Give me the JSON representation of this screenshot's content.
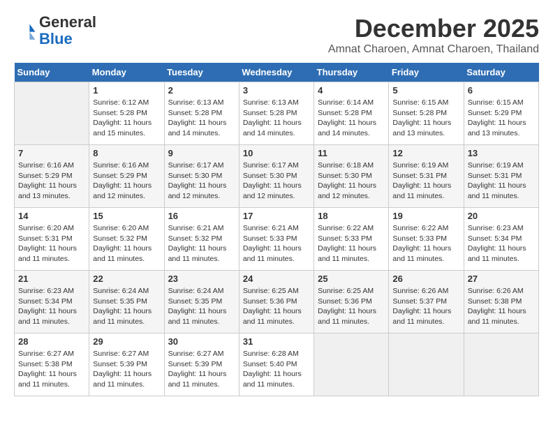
{
  "header": {
    "logo_general": "General",
    "logo_blue": "Blue",
    "month_year": "December 2025",
    "location": "Amnat Charoen, Amnat Charoen, Thailand"
  },
  "calendar": {
    "days_of_week": [
      "Sunday",
      "Monday",
      "Tuesday",
      "Wednesday",
      "Thursday",
      "Friday",
      "Saturday"
    ],
    "weeks": [
      [
        {
          "day": "",
          "info": ""
        },
        {
          "day": "1",
          "info": "Sunrise: 6:12 AM\nSunset: 5:28 PM\nDaylight: 11 hours\nand 15 minutes."
        },
        {
          "day": "2",
          "info": "Sunrise: 6:13 AM\nSunset: 5:28 PM\nDaylight: 11 hours\nand 14 minutes."
        },
        {
          "day": "3",
          "info": "Sunrise: 6:13 AM\nSunset: 5:28 PM\nDaylight: 11 hours\nand 14 minutes."
        },
        {
          "day": "4",
          "info": "Sunrise: 6:14 AM\nSunset: 5:28 PM\nDaylight: 11 hours\nand 14 minutes."
        },
        {
          "day": "5",
          "info": "Sunrise: 6:15 AM\nSunset: 5:28 PM\nDaylight: 11 hours\nand 13 minutes."
        },
        {
          "day": "6",
          "info": "Sunrise: 6:15 AM\nSunset: 5:29 PM\nDaylight: 11 hours\nand 13 minutes."
        }
      ],
      [
        {
          "day": "7",
          "info": "Sunrise: 6:16 AM\nSunset: 5:29 PM\nDaylight: 11 hours\nand 13 minutes."
        },
        {
          "day": "8",
          "info": "Sunrise: 6:16 AM\nSunset: 5:29 PM\nDaylight: 11 hours\nand 12 minutes."
        },
        {
          "day": "9",
          "info": "Sunrise: 6:17 AM\nSunset: 5:30 PM\nDaylight: 11 hours\nand 12 minutes."
        },
        {
          "day": "10",
          "info": "Sunrise: 6:17 AM\nSunset: 5:30 PM\nDaylight: 11 hours\nand 12 minutes."
        },
        {
          "day": "11",
          "info": "Sunrise: 6:18 AM\nSunset: 5:30 PM\nDaylight: 11 hours\nand 12 minutes."
        },
        {
          "day": "12",
          "info": "Sunrise: 6:19 AM\nSunset: 5:31 PM\nDaylight: 11 hours\nand 11 minutes."
        },
        {
          "day": "13",
          "info": "Sunrise: 6:19 AM\nSunset: 5:31 PM\nDaylight: 11 hours\nand 11 minutes."
        }
      ],
      [
        {
          "day": "14",
          "info": "Sunrise: 6:20 AM\nSunset: 5:31 PM\nDaylight: 11 hours\nand 11 minutes."
        },
        {
          "day": "15",
          "info": "Sunrise: 6:20 AM\nSunset: 5:32 PM\nDaylight: 11 hours\nand 11 minutes."
        },
        {
          "day": "16",
          "info": "Sunrise: 6:21 AM\nSunset: 5:32 PM\nDaylight: 11 hours\nand 11 minutes."
        },
        {
          "day": "17",
          "info": "Sunrise: 6:21 AM\nSunset: 5:33 PM\nDaylight: 11 hours\nand 11 minutes."
        },
        {
          "day": "18",
          "info": "Sunrise: 6:22 AM\nSunset: 5:33 PM\nDaylight: 11 hours\nand 11 minutes."
        },
        {
          "day": "19",
          "info": "Sunrise: 6:22 AM\nSunset: 5:33 PM\nDaylight: 11 hours\nand 11 minutes."
        },
        {
          "day": "20",
          "info": "Sunrise: 6:23 AM\nSunset: 5:34 PM\nDaylight: 11 hours\nand 11 minutes."
        }
      ],
      [
        {
          "day": "21",
          "info": "Sunrise: 6:23 AM\nSunset: 5:34 PM\nDaylight: 11 hours\nand 11 minutes."
        },
        {
          "day": "22",
          "info": "Sunrise: 6:24 AM\nSunset: 5:35 PM\nDaylight: 11 hours\nand 11 minutes."
        },
        {
          "day": "23",
          "info": "Sunrise: 6:24 AM\nSunset: 5:35 PM\nDaylight: 11 hours\nand 11 minutes."
        },
        {
          "day": "24",
          "info": "Sunrise: 6:25 AM\nSunset: 5:36 PM\nDaylight: 11 hours\nand 11 minutes."
        },
        {
          "day": "25",
          "info": "Sunrise: 6:25 AM\nSunset: 5:36 PM\nDaylight: 11 hours\nand 11 minutes."
        },
        {
          "day": "26",
          "info": "Sunrise: 6:26 AM\nSunset: 5:37 PM\nDaylight: 11 hours\nand 11 minutes."
        },
        {
          "day": "27",
          "info": "Sunrise: 6:26 AM\nSunset: 5:38 PM\nDaylight: 11 hours\nand 11 minutes."
        }
      ],
      [
        {
          "day": "28",
          "info": "Sunrise: 6:27 AM\nSunset: 5:38 PM\nDaylight: 11 hours\nand 11 minutes."
        },
        {
          "day": "29",
          "info": "Sunrise: 6:27 AM\nSunset: 5:39 PM\nDaylight: 11 hours\nand 11 minutes."
        },
        {
          "day": "30",
          "info": "Sunrise: 6:27 AM\nSunset: 5:39 PM\nDaylight: 11 hours\nand 11 minutes."
        },
        {
          "day": "31",
          "info": "Sunrise: 6:28 AM\nSunset: 5:40 PM\nDaylight: 11 hours\nand 11 minutes."
        },
        {
          "day": "",
          "info": ""
        },
        {
          "day": "",
          "info": ""
        },
        {
          "day": "",
          "info": ""
        }
      ]
    ]
  }
}
